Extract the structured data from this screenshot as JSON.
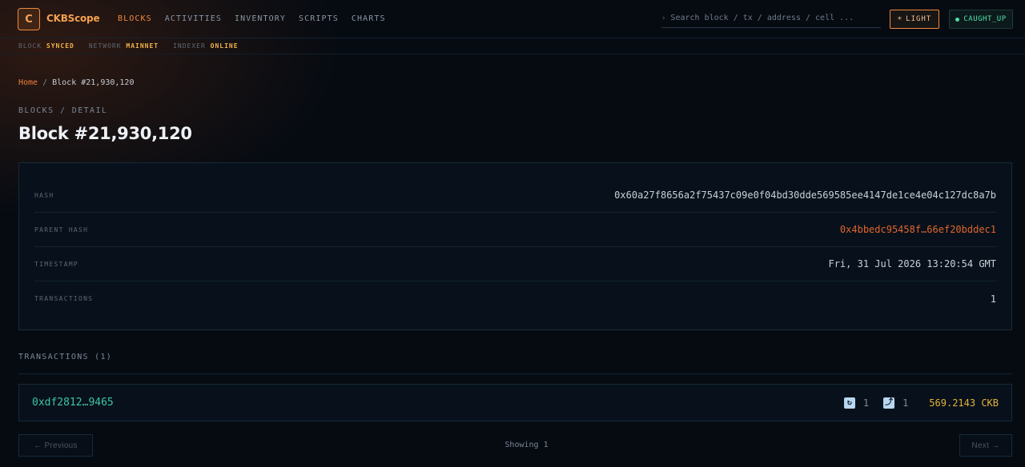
{
  "header": {
    "logo_letter": "C",
    "app_name": "CKBScope",
    "nav": [
      {
        "label": "BLOCKS",
        "active": true
      },
      {
        "label": "ACTIVITIES",
        "active": false
      },
      {
        "label": "INVENTORY",
        "active": false
      },
      {
        "label": "SCRIPTS",
        "active": false
      },
      {
        "label": "CHARTS",
        "active": false
      }
    ],
    "search_placeholder": "Search block / tx / address / cell ...",
    "theme_button": "LIGHT",
    "sync_status": "CAUGHT_UP"
  },
  "subbar": {
    "items": [
      {
        "label": "BLOCK",
        "value": "SYNCED"
      },
      {
        "label": "NETWORK",
        "value": "MAINNET"
      },
      {
        "label": "INDEXER",
        "value": "ONLINE"
      }
    ]
  },
  "breadcrumb": {
    "home": "Home",
    "separator": "/",
    "current": "Block #21,930,120"
  },
  "eyebrow": "BLOCKS / DETAIL",
  "title": "Block #21,930,120",
  "details": [
    {
      "label": "HASH",
      "value": "0x60a27f8656a2f75437c09e0f04bd30dde569585ee4147de1ce4e04c127dc8a7b",
      "link": false
    },
    {
      "label": "PARENT HASH",
      "value": "0x4bbedc95458f…66ef20bddec1",
      "link": true
    },
    {
      "label": "TIMESTAMP",
      "value": "Fri, 31 Jul 2026 13:20:54 GMT",
      "link": false
    },
    {
      "label": "TRANSACTIONS",
      "value": "1",
      "link": false
    }
  ],
  "transactions": {
    "heading": "TRANSACTIONS (1)",
    "rows": [
      {
        "hash": "0xdf2812…9465",
        "inputs": "1",
        "outputs": "1",
        "amount": "569.2143 CKB"
      }
    ]
  },
  "pagination": {
    "prev": "← Previous",
    "showing": "Showing 1",
    "next": "Next →"
  },
  "colors": {
    "accent": "#f08a3c",
    "link": "#e0652b",
    "tx": "#3fc4a8",
    "amount": "#e4b23a",
    "status": "#4fe0a6"
  }
}
